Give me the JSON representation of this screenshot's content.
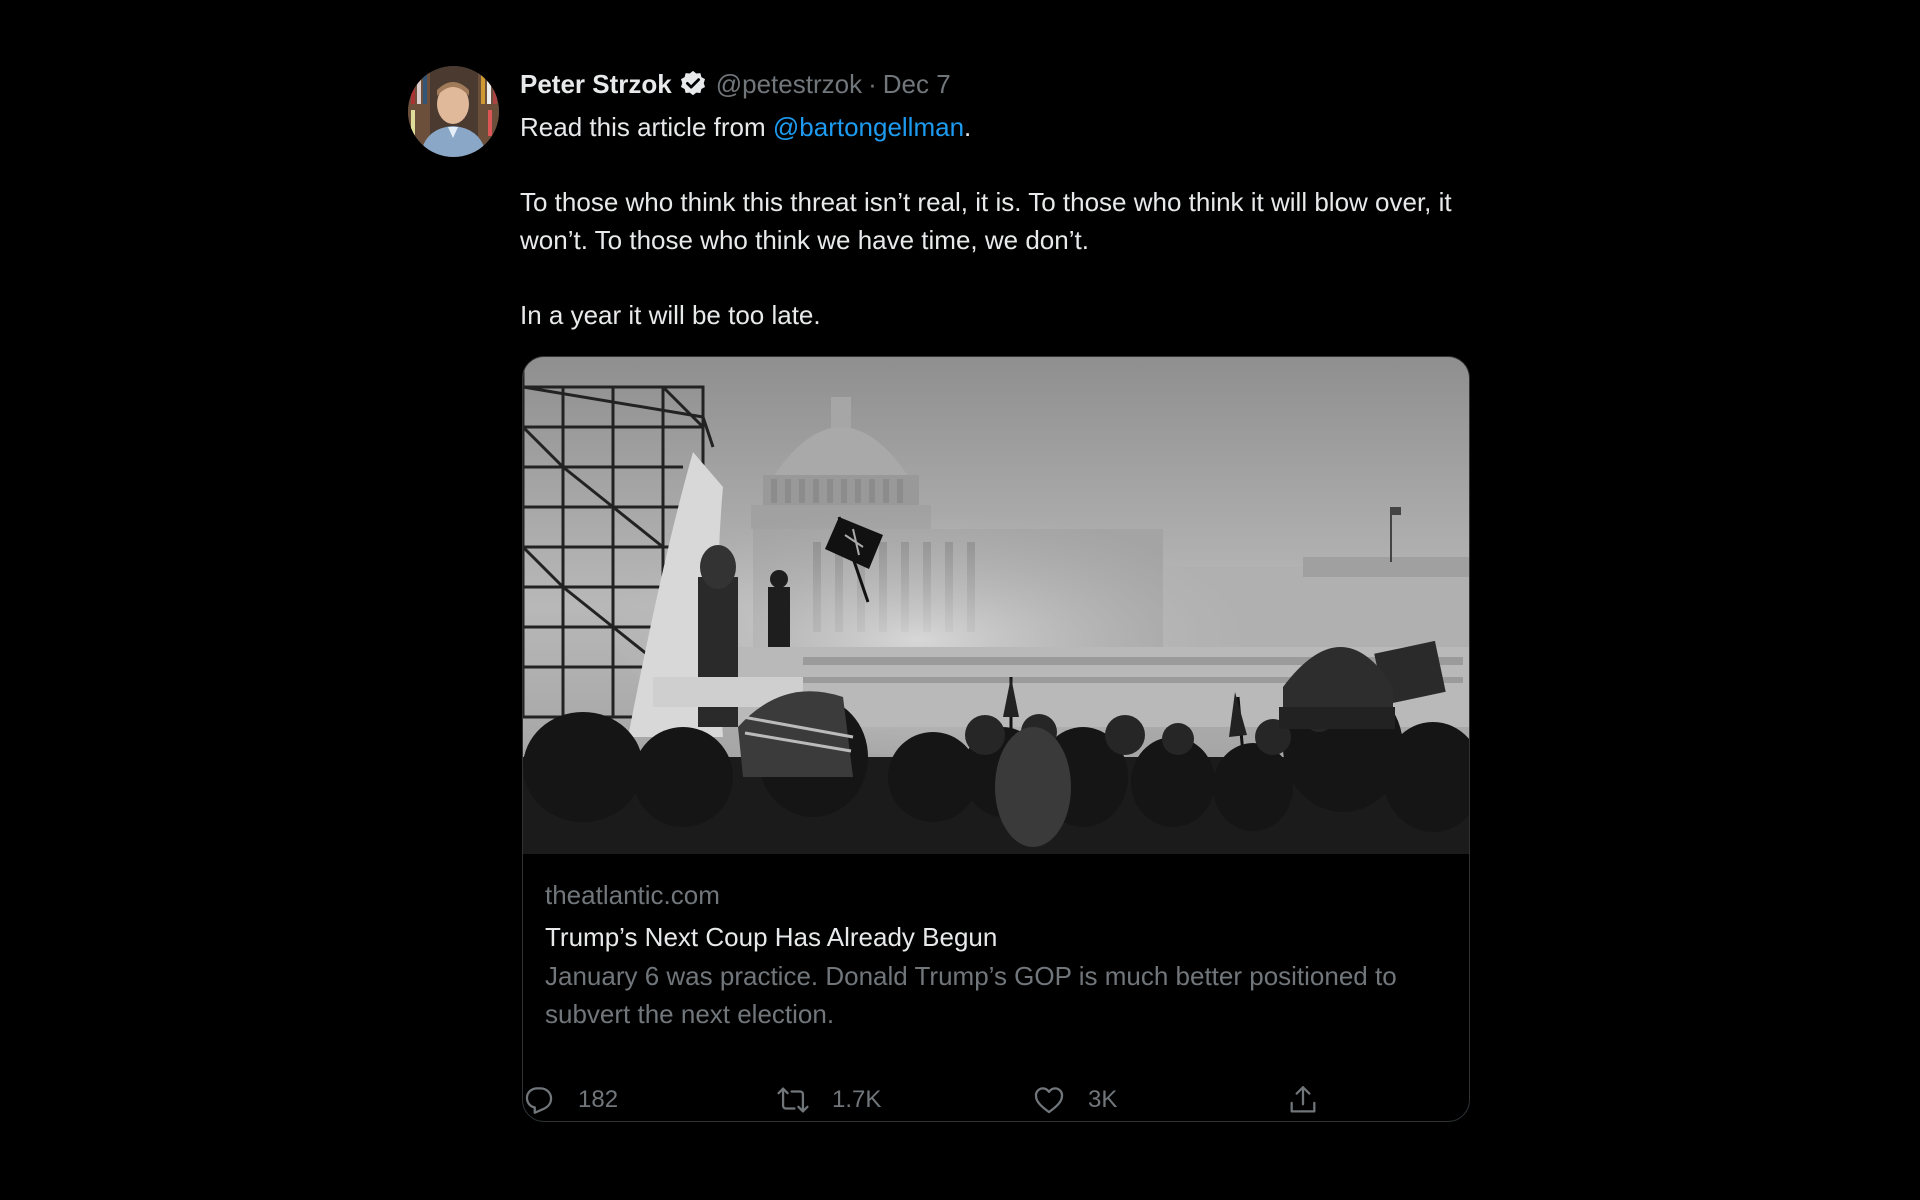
{
  "tweet": {
    "author_name": "Peter Strzok",
    "handle": "@petestrzok",
    "separator": "·",
    "date": "Dec 7",
    "text_prefix": "Read this article from ",
    "mention": "@bartongellman",
    "text_suffix": ".",
    "paragraph_2": "To those who think this threat isn’t real, it is. To those who think it will blow over, it won’t. To those who think we have time, we don’t.",
    "paragraph_3": "In a year it will be too late."
  },
  "card": {
    "domain": "theatlantic.com",
    "title": "Trump’s Next Coup Has Already Begun",
    "description": "January 6 was practice. Donald Trump’s GOP is much better positioned to subvert the next election."
  },
  "actions": {
    "reply_count": "182",
    "retweet_count": "1.7K",
    "like_count": "3K"
  },
  "colors": {
    "background": "#000000",
    "text": "#e7e9ea",
    "secondary": "#71767b",
    "accent": "#1d9bf0",
    "border": "#2f3336"
  },
  "icons": {
    "verified": "verified-badge-icon",
    "reply": "reply-icon",
    "retweet": "retweet-icon",
    "like": "heart-icon",
    "share": "share-icon"
  }
}
